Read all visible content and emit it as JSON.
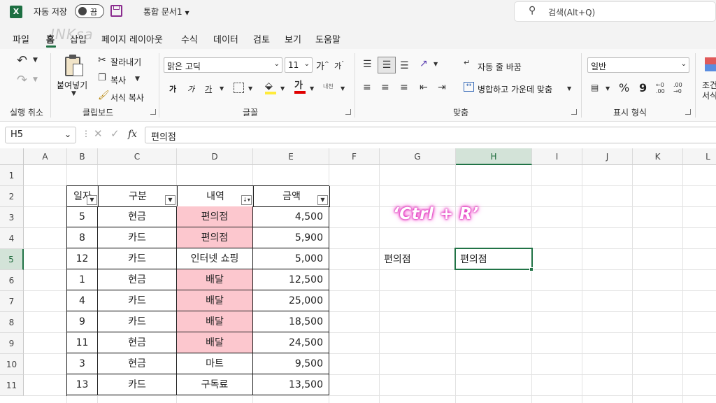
{
  "titlebar": {
    "app_icon": "X",
    "autosave_label": "자동 저장",
    "autosave_state": "끔",
    "save_icon": "save-icon",
    "doc_title": "통합 문서1",
    "search_placeholder": "검색(Alt+Q)"
  },
  "watermark": "INKsa",
  "menu": [
    "파일",
    "홈",
    "삽입",
    "페이지 레이아웃",
    "수식",
    "데이터",
    "검토",
    "보기",
    "도움말"
  ],
  "ribbon": {
    "undo_group": "실행 취소",
    "clipboard": {
      "paste": "붙여넣기",
      "cut": "잘라내기",
      "copy": "복사",
      "format_painter": "서식 복사",
      "group": "클립보드"
    },
    "font": {
      "name": "맑은 고딕",
      "size": "11",
      "grow": "가",
      "shrink": "가",
      "bold": "가",
      "italic": "가",
      "underline": "가",
      "color_letter": "가",
      "phonetic": "내천",
      "group": "글꼴"
    },
    "alignment": {
      "wrap": "자동 줄 바꿈",
      "merge": "병합하고 가운데 맞춤",
      "group": "맞춤"
    },
    "number": {
      "format": "일반",
      "percent": "%",
      "comma": "9",
      "group": "표시 형식"
    },
    "styles": {
      "conditional": "조건",
      "format": "서식"
    }
  },
  "formula_bar": {
    "name_box": "H5",
    "fx": "fx",
    "content": "편의점"
  },
  "columns": [
    "A",
    "B",
    "C",
    "D",
    "E",
    "F",
    "G",
    "H",
    "I",
    "J",
    "K",
    "L"
  ],
  "rows": [
    "1",
    "2",
    "3",
    "4",
    "5",
    "6",
    "7",
    "8",
    "9",
    "10",
    "11"
  ],
  "table": {
    "headers": [
      "일자",
      "구분",
      "내역",
      "금액"
    ],
    "rows": [
      {
        "day": "5",
        "type": "현금",
        "item": "편의점",
        "amount": "4,500",
        "hl": true
      },
      {
        "day": "8",
        "type": "카드",
        "item": "편의점",
        "amount": "5,900",
        "hl": true
      },
      {
        "day": "12",
        "type": "카드",
        "item": "인터넷 쇼핑",
        "amount": "5,000",
        "hl": false
      },
      {
        "day": "1",
        "type": "현금",
        "item": "배달",
        "amount": "12,500",
        "hl": true
      },
      {
        "day": "4",
        "type": "카드",
        "item": "배달",
        "amount": "25,000",
        "hl": true
      },
      {
        "day": "9",
        "type": "카드",
        "item": "배달",
        "amount": "18,500",
        "hl": true
      },
      {
        "day": "11",
        "type": "현금",
        "item": "배달",
        "amount": "24,500",
        "hl": true
      },
      {
        "day": "3",
        "type": "현금",
        "item": "마트",
        "amount": "9,500",
        "hl": false
      },
      {
        "day": "13",
        "type": "카드",
        "item": "구독료",
        "amount": "13,500",
        "hl": false
      }
    ]
  },
  "cells": {
    "g5": "편의점",
    "h5": "편의점"
  },
  "annotation": "‘Ctrl + R’",
  "colors": {
    "accent": "#217346",
    "highlight": "#fcc7ce"
  }
}
